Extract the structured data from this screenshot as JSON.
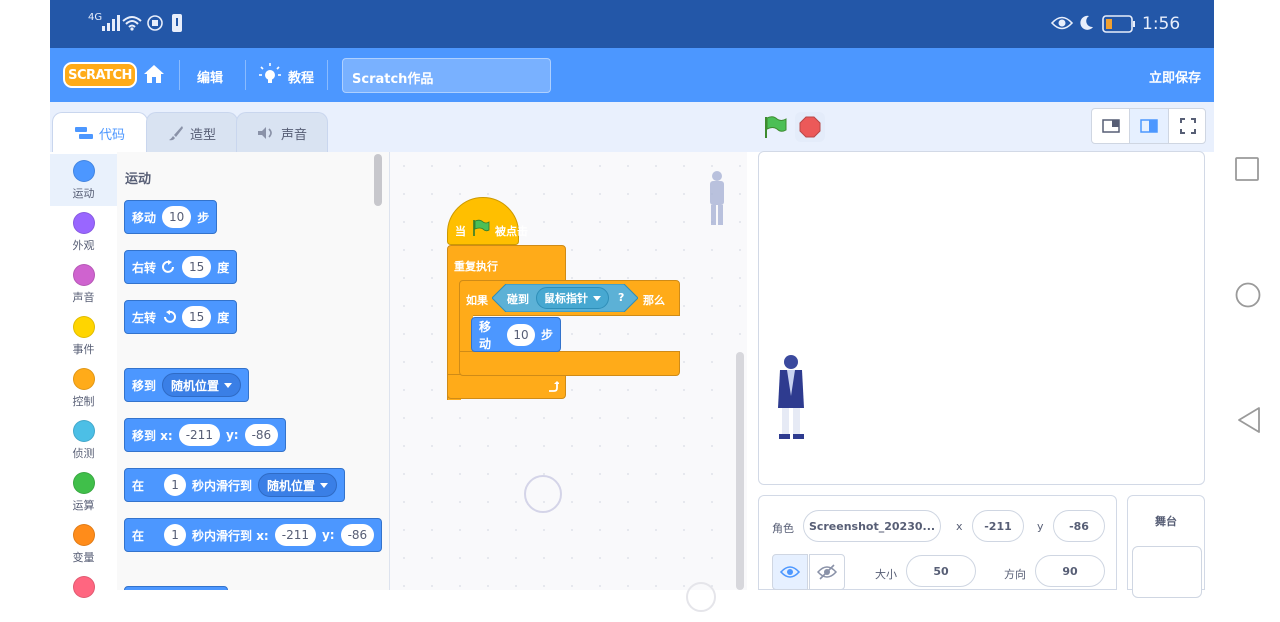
{
  "status_bar": {
    "network": "4G",
    "time": "1:56"
  },
  "menu": {
    "logo": "SCRATCH",
    "edit": "编辑",
    "tutorials": "教程",
    "project_title": "Scratch作品",
    "save_now": "立即保存"
  },
  "tabs": [
    {
      "label": "代码"
    },
    {
      "label": "造型"
    },
    {
      "label": "声音"
    }
  ],
  "categories": [
    {
      "label": "运动",
      "color": "#4c97ff"
    },
    {
      "label": "外观",
      "color": "#9966ff"
    },
    {
      "label": "声音",
      "color": "#cf63cf"
    },
    {
      "label": "事件",
      "color": "#ffd500"
    },
    {
      "label": "控制",
      "color": "#ffab19"
    },
    {
      "label": "侦测",
      "color": "#4cbfe6"
    },
    {
      "label": "运算",
      "color": "#40bf4a"
    },
    {
      "label": "变量",
      "color": "#ff8c1a"
    },
    {
      "label": "",
      "color": "#ff6680"
    }
  ],
  "palette": {
    "section_title": "运动",
    "move": {
      "label": "移动",
      "steps": "10",
      "unit": "步"
    },
    "turn_right": {
      "label": "右转",
      "degrees": "15",
      "unit": "度"
    },
    "turn_left": {
      "label": "左转",
      "degrees": "15",
      "unit": "度"
    },
    "goto": {
      "label": "移到",
      "target": "随机位置"
    },
    "goto_xy": {
      "label": "移到 x:",
      "x": "-211",
      "ylabel": "y:",
      "y": "-86"
    },
    "glide_to": {
      "label": "在",
      "secs": "1",
      "mid": "秒内滑行到",
      "target": "随机位置"
    },
    "glide_xy": {
      "label": "在",
      "secs": "1",
      "mid": "秒内滑行到 x:",
      "x": "-211",
      "ylabel": "y:",
      "y": "-86"
    }
  },
  "script": {
    "hat_when": "当",
    "hat_clicked": "被点击",
    "forever": "重复执行",
    "if": "如果",
    "then": "那么",
    "touching": "碰到",
    "touch_target": "鼠标指针",
    "question": "?",
    "move_label": "移动",
    "move_steps": "10",
    "move_unit": "步"
  },
  "sprite_info": {
    "sprite_label": "角色",
    "sprite_name": "Screenshot_20230...",
    "x_label": "x",
    "x": "-211",
    "y_label": "y",
    "y": "-86",
    "size_label": "大小",
    "size": "50",
    "direction_label": "方向",
    "direction": "90"
  },
  "stage_panel": {
    "label": "舞台"
  }
}
